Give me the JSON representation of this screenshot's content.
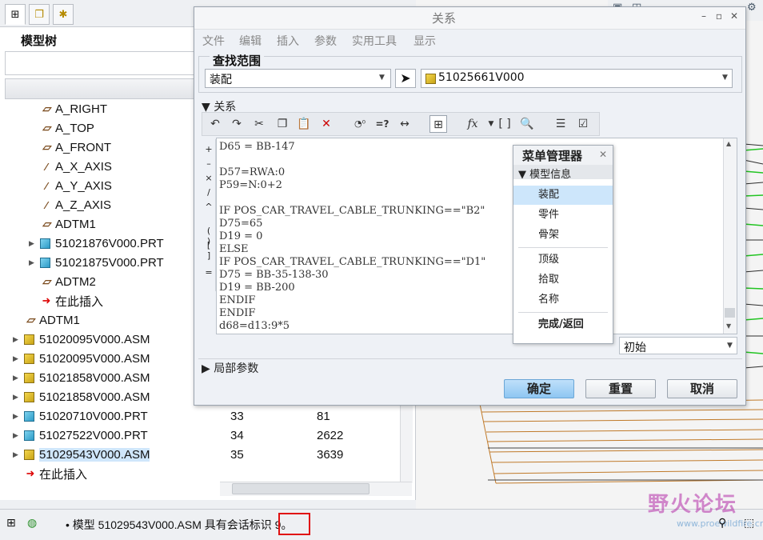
{
  "tree": {
    "title": "模型树",
    "rows": [
      {
        "label": "A_RIGHT",
        "icon": "datum-plane-icon",
        "indent": 50,
        "arrow": false
      },
      {
        "label": "A_TOP",
        "icon": "datum-plane-icon",
        "indent": 50,
        "arrow": false
      },
      {
        "label": "A_FRONT",
        "icon": "datum-plane-icon",
        "indent": 50,
        "arrow": false
      },
      {
        "label": "A_X_AXIS",
        "icon": "datum-axis-icon",
        "indent": 50,
        "arrow": false
      },
      {
        "label": "A_Y_AXIS",
        "icon": "datum-axis-icon",
        "indent": 50,
        "arrow": false
      },
      {
        "label": "A_Z_AXIS",
        "icon": "datum-axis-icon",
        "indent": 50,
        "arrow": false
      },
      {
        "label": "ADTM1",
        "icon": "datum-plane-icon",
        "indent": 50,
        "arrow": false
      },
      {
        "label": "51021876V000.PRT",
        "icon": "part-icon",
        "indent": 50,
        "arrow": true
      },
      {
        "label": "51021875V000.PRT",
        "icon": "part-icon",
        "indent": 50,
        "arrow": true
      },
      {
        "label": "ADTM2",
        "icon": "datum-plane-icon",
        "indent": 50,
        "arrow": false
      },
      {
        "label": "在此插入",
        "icon": "insert-here-icon",
        "indent": 50,
        "arrow": false
      },
      {
        "label": "ADTM1",
        "icon": "datum-plane-icon",
        "indent": 30,
        "arrow": false
      },
      {
        "label": "51020095V000.ASM",
        "icon": "assembly-icon",
        "indent": 30,
        "arrow": true
      },
      {
        "label": "51020095V000.ASM",
        "icon": "assembly-icon",
        "indent": 30,
        "arrow": true
      },
      {
        "label": "51021858V000.ASM",
        "icon": "assembly-icon",
        "indent": 30,
        "arrow": true
      },
      {
        "label": "51021858V000.ASM",
        "icon": "assembly-icon",
        "indent": 30,
        "arrow": true
      },
      {
        "label": "51020710V000.PRT",
        "icon": "part-icon",
        "indent": 30,
        "arrow": true,
        "c1": "33",
        "c2": "81"
      },
      {
        "label": "51027522V000.PRT",
        "icon": "part-icon",
        "indent": 30,
        "arrow": true,
        "c1": "34",
        "c2": "2622"
      },
      {
        "label": "51029543V000.ASM",
        "icon": "assembly-icon",
        "indent": 30,
        "arrow": true,
        "c1": "35",
        "c2": "3639",
        "selected": true
      },
      {
        "label": "在此插入",
        "icon": "insert-here-icon",
        "indent": 30,
        "arrow": false
      }
    ]
  },
  "dialog": {
    "title": "关系",
    "menu": [
      "文件",
      "编辑",
      "插入",
      "参数",
      "实用工具",
      "显示"
    ],
    "scope_label": "查找范围",
    "scope_value": "装配",
    "model_value": "51025661V000",
    "relations_label": "关系",
    "code_lines": [
      "D65 = BB-147",
      "",
      "D57=RWA:0",
      "P59=N:0+2",
      "",
      "IF POS_CAR_TRAVEL_CABLE_TRUNKING==\"B2\"",
      "D75=65",
      "D19 = 0",
      "ELSE",
      "IF POS_CAR_TRAVEL_CABLE_TRUNKING==\"D1\"",
      "D75 = BB-35-138-30",
      "D19 = BB-200",
      "ENDIF",
      "ENDIF",
      "d68=d13:9*5"
    ],
    "initial_value": "初始",
    "local_params_label": "局部参数",
    "ok_label": "确定",
    "reset_label": "重置",
    "cancel_label": "取消"
  },
  "menu_manager": {
    "title": "菜单管理器",
    "section": "模型信息",
    "items": [
      "装配",
      "零件",
      "骨架"
    ],
    "items2": [
      "顶级",
      "拾取",
      "名称"
    ],
    "done": "完成/返回"
  },
  "status": {
    "message": "• 模型 51029543V000.ASM 具有会话标识 9。"
  },
  "watermark": {
    "title": "野火论坛",
    "url": "www.proewildfire.cn"
  }
}
